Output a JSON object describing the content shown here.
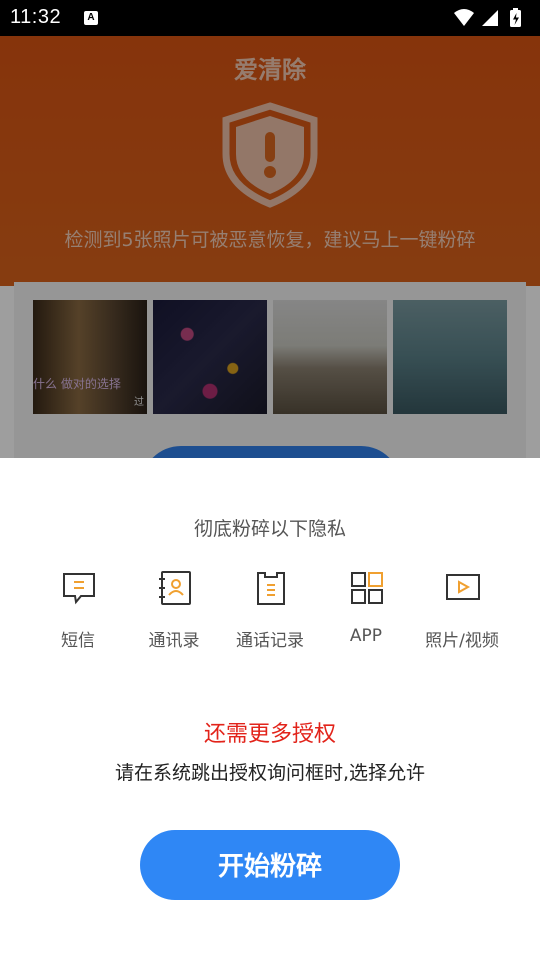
{
  "status_bar": {
    "time": "11:32",
    "notification_badge": "A"
  },
  "header": {
    "app_title": "爱清除",
    "warning_text": "检测到5张照片可被恶意恢复，建议马上一键粉碎"
  },
  "thumbnails": [
    {
      "caption": "什么   做对的选择",
      "caption2": "过"
    },
    {
      "caption": "",
      "caption2": ""
    },
    {
      "caption": "",
      "caption2": ""
    },
    {
      "caption": "",
      "caption2": ""
    }
  ],
  "sheet": {
    "title": "彻底粉碎以下隐私",
    "items": [
      {
        "label": "短信",
        "icon": "sms-icon"
      },
      {
        "label": "通讯录",
        "icon": "contacts-icon"
      },
      {
        "label": "通话记录",
        "icon": "call-log-icon"
      },
      {
        "label": "APP",
        "icon": "apps-grid-icon"
      },
      {
        "label": "照片/视频",
        "icon": "video-icon"
      }
    ],
    "more_permission_title": "还需更多授权",
    "more_permission_desc": "请在系统跳出授权询问框时,选择允许",
    "start_button": "开始粉碎"
  },
  "colors": {
    "hero_orange": "#d85413",
    "accent_blue": "#2f87f5",
    "icon_orange": "#f0a030",
    "alert_red": "#e2231a"
  }
}
